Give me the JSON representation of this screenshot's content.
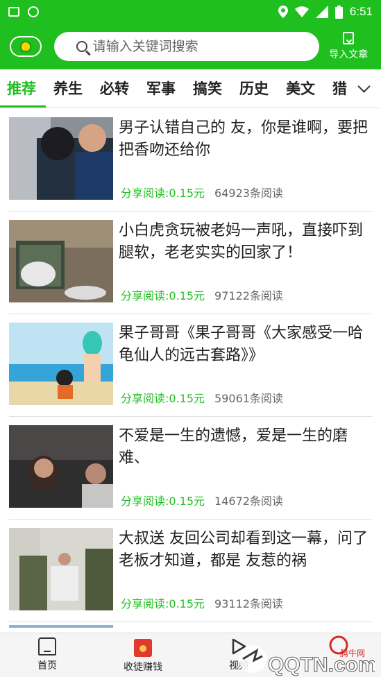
{
  "status_bar": {
    "time": "6:51",
    "icons": [
      "image-icon",
      "vpn-icon",
      "location-icon",
      "wifi-icon",
      "signal-icon",
      "battery-icon"
    ]
  },
  "header": {
    "search_placeholder": "请输入关键词搜索",
    "import_label": "导入文章"
  },
  "tabs": [
    "推荐",
    "养生",
    "必转",
    "军事",
    "搞笑",
    "历史",
    "美文",
    "猎"
  ],
  "active_tab": "推荐",
  "feed": [
    {
      "title": "男子认错自己的 友，你是谁啊，要把把香吻还给你",
      "reward": "分享阅读:0.15元",
      "reads": "64923条阅读"
    },
    {
      "title": "小白虎贪玩被老妈一声吼，直接吓到腿软，老老实实的回家了！",
      "reward": "分享阅读:0.15元",
      "reads": "97122条阅读"
    },
    {
      "title": "果子哥哥《果子哥哥《大家感受一哈龟仙人的远古套路》》",
      "reward": "分享阅读:0.15元",
      "reads": "59061条阅读"
    },
    {
      "title": "不爱是一生的遗憾，爱是一生的磨难、",
      "reward": "分享阅读:0.15元",
      "reads": "14672条阅读"
    },
    {
      "title": "大叔送 友回公司却看到这一幕，问了老板才知道，都是 友惹的祸",
      "reward": "分享阅读:0.15元",
      "reads": "93112条阅读"
    }
  ],
  "bottom_nav": {
    "home": "首页",
    "earn": "收徒赚钱",
    "video": "视频"
  },
  "watermark": {
    "site": "腾牛网",
    "domain": "QQTN.com"
  },
  "colors": {
    "brand_green": "#1fbf1f",
    "reward_green": "#1fbf1f"
  }
}
